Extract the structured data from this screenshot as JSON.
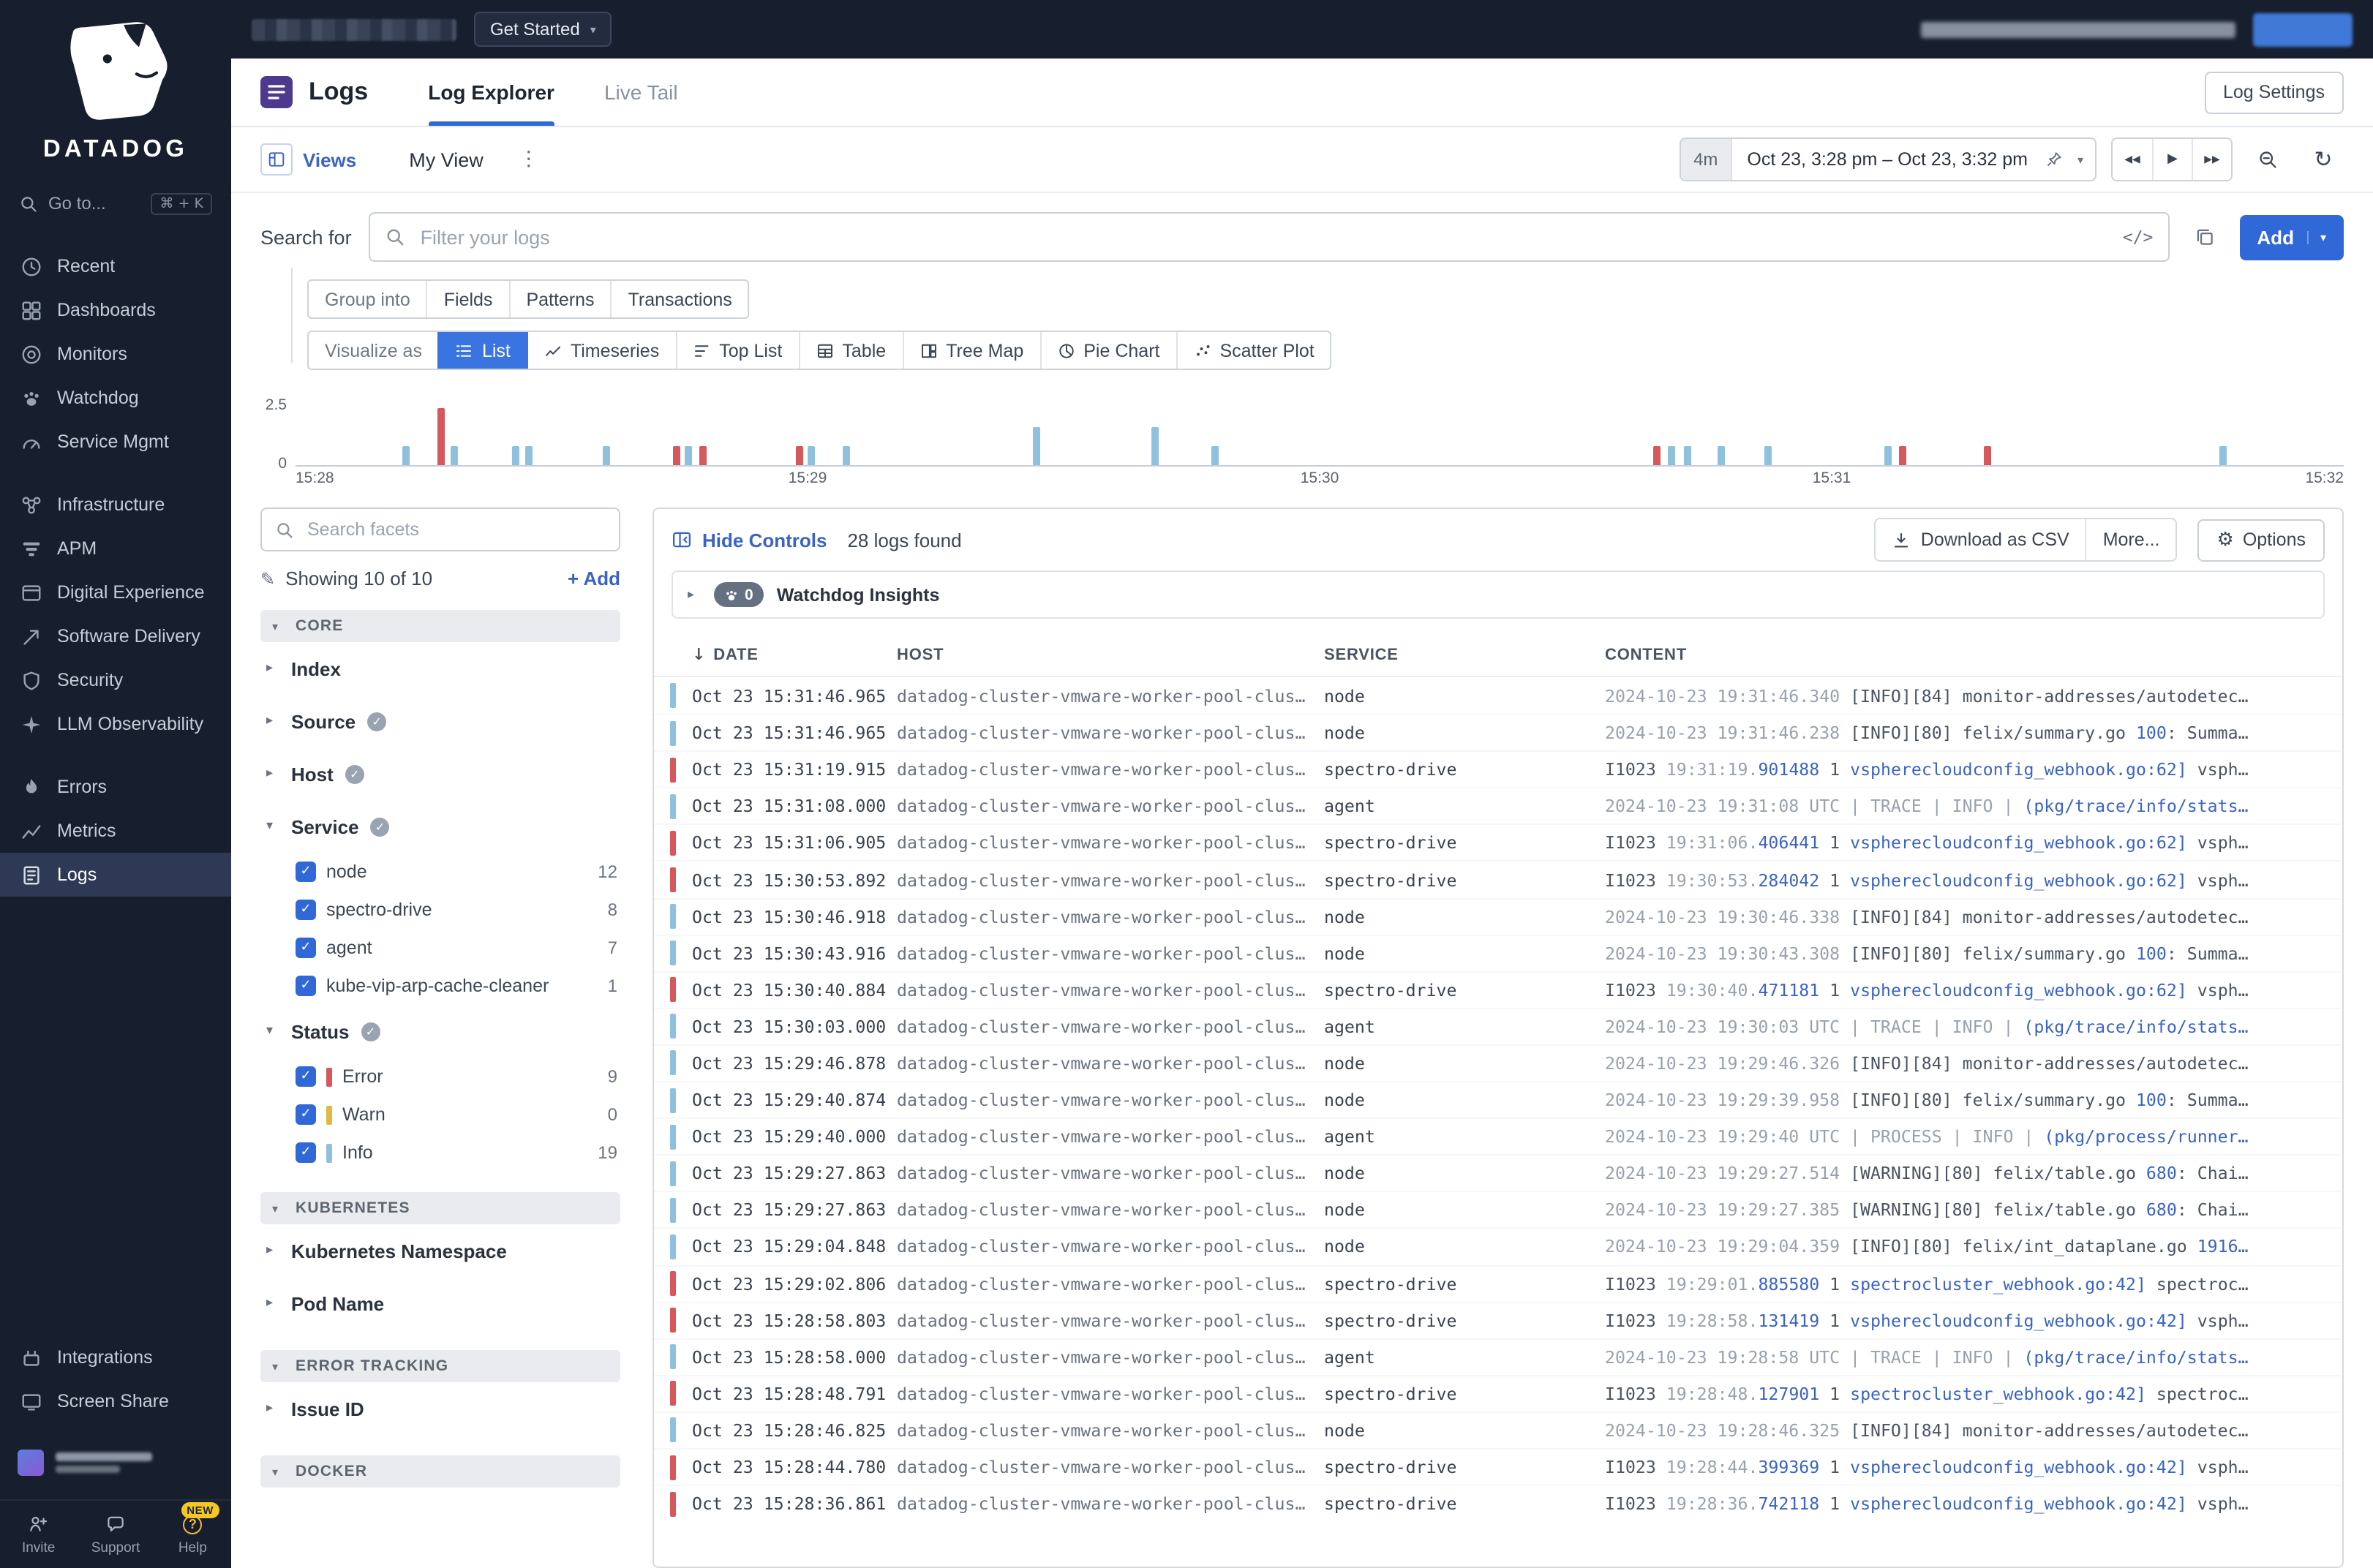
{
  "topbar": {
    "get_started": "Get Started"
  },
  "sidebar": {
    "brand": "DATADOG",
    "goto": {
      "label": "Go to...",
      "shortcut": "⌘ + K"
    },
    "groups": [
      {
        "items": [
          {
            "icon": "clock",
            "label": "Recent"
          },
          {
            "icon": "dashboards",
            "label": "Dashboards"
          },
          {
            "icon": "monitors",
            "label": "Monitors"
          },
          {
            "icon": "watchdog",
            "label": "Watchdog"
          },
          {
            "icon": "service-mgmt",
            "label": "Service Mgmt"
          }
        ]
      },
      {
        "items": [
          {
            "icon": "infrastructure",
            "label": "Infrastructure"
          },
          {
            "icon": "apm",
            "label": "APM"
          },
          {
            "icon": "digital-experience",
            "label": "Digital Experience"
          },
          {
            "icon": "software-delivery",
            "label": "Software Delivery"
          },
          {
            "icon": "security",
            "label": "Security"
          },
          {
            "icon": "llm",
            "label": "LLM Observability"
          }
        ]
      },
      {
        "items": [
          {
            "icon": "errors",
            "label": "Errors"
          },
          {
            "icon": "metrics",
            "label": "Metrics"
          },
          {
            "icon": "logs",
            "label": "Logs",
            "active": true
          }
        ]
      },
      {
        "items": [
          {
            "icon": "integrations",
            "label": "Integrations"
          },
          {
            "icon": "screen-share",
            "label": "Screen Share"
          }
        ]
      }
    ],
    "footer": [
      {
        "icon": "invite",
        "label": "Invite"
      },
      {
        "icon": "support",
        "label": "Support"
      },
      {
        "icon": "help",
        "label": "Help",
        "badge": "NEW"
      }
    ]
  },
  "header": {
    "product": "Logs",
    "tabs": [
      {
        "label": "Log Explorer",
        "active": true
      },
      {
        "label": "Live Tail"
      }
    ],
    "settings_button": "Log Settings"
  },
  "viewbar": {
    "views_label": "Views",
    "view_name": "My View",
    "time_range": {
      "duration": "4m",
      "text": "Oct 23, 3:28 pm – Oct 23, 3:32 pm"
    }
  },
  "search": {
    "label": "Search for",
    "placeholder": "Filter your logs",
    "add_button": "Add"
  },
  "group_into": {
    "label": "Group into",
    "tabs": [
      "Fields",
      "Patterns",
      "Transactions"
    ]
  },
  "visualize": {
    "label": "Visualize as",
    "tabs": [
      {
        "icon": "list",
        "label": "List",
        "active": true
      },
      {
        "icon": "timeseries",
        "label": "Timeseries"
      },
      {
        "icon": "toplist",
        "label": "Top List"
      },
      {
        "icon": "table",
        "label": "Table"
      },
      {
        "icon": "treemap",
        "label": "Tree Map"
      },
      {
        "icon": "pie",
        "label": "Pie Chart"
      },
      {
        "icon": "scatter",
        "label": "Scatter Plot"
      }
    ]
  },
  "chart_data": {
    "type": "bar",
    "title": "Log count over time",
    "x_ticks": [
      "15:28",
      "15:29",
      "15:30",
      "15:31",
      "15:32"
    ],
    "y_ticks": [
      "0",
      "2.5"
    ],
    "y_max": 3,
    "legend": [
      {
        "name": "Info",
        "color": "#8fc1de"
      },
      {
        "name": "Error",
        "color": "#d4585c"
      }
    ],
    "bars": [
      {
        "x": 0.052,
        "value": 1,
        "status": "info"
      },
      {
        "x": 0.069,
        "value": 3,
        "status": "error"
      },
      {
        "x": 0.076,
        "value": 1,
        "status": "info"
      },
      {
        "x": 0.106,
        "value": 1,
        "status": "info"
      },
      {
        "x": 0.112,
        "value": 1,
        "status": "info"
      },
      {
        "x": 0.15,
        "value": 1,
        "status": "info"
      },
      {
        "x": 0.184,
        "value": 1,
        "status": "error"
      },
      {
        "x": 0.19,
        "value": 1,
        "status": "info"
      },
      {
        "x": 0.197,
        "value": 1,
        "status": "error"
      },
      {
        "x": 0.244,
        "value": 1,
        "status": "error"
      },
      {
        "x": 0.25,
        "value": 1,
        "status": "info"
      },
      {
        "x": 0.267,
        "value": 1,
        "status": "info"
      },
      {
        "x": 0.36,
        "value": 2,
        "status": "info"
      },
      {
        "x": 0.418,
        "value": 2,
        "status": "info"
      },
      {
        "x": 0.447,
        "value": 1,
        "status": "info"
      },
      {
        "x": 0.663,
        "value": 1,
        "status": "error"
      },
      {
        "x": 0.67,
        "value": 1,
        "status": "info"
      },
      {
        "x": 0.678,
        "value": 1,
        "status": "info"
      },
      {
        "x": 0.694,
        "value": 1,
        "status": "info"
      },
      {
        "x": 0.717,
        "value": 1,
        "status": "info"
      },
      {
        "x": 0.776,
        "value": 1,
        "status": "info"
      },
      {
        "x": 0.783,
        "value": 1,
        "status": "error"
      },
      {
        "x": 0.824,
        "value": 1,
        "status": "error"
      },
      {
        "x": 0.939,
        "value": 1,
        "status": "info"
      }
    ]
  },
  "controls": {
    "hide_controls": "Hide Controls",
    "logs_found": "28 logs found",
    "download_csv": "Download as CSV",
    "more": "More...",
    "options": "Options"
  },
  "watchdog": {
    "count": "0",
    "label": "Watchdog Insights"
  },
  "facets": {
    "search_placeholder": "Search facets",
    "showing": "Showing 10 of 10",
    "add_label": "Add",
    "sections": [
      {
        "title": "CORE",
        "items": [
          {
            "label": "Index"
          },
          {
            "label": "Source",
            "badge": true
          },
          {
            "label": "Host",
            "badge": true
          },
          {
            "label": "Service",
            "badge": true,
            "expanded": true,
            "values": [
              {
                "label": "node",
                "count": "12",
                "checked": true
              },
              {
                "label": "spectro-drive",
                "count": "8",
                "checked": true
              },
              {
                "label": "agent",
                "count": "7",
                "checked": true
              },
              {
                "label": "kube-vip-arp-cache-cleaner",
                "count": "1",
                "checked": true
              }
            ]
          },
          {
            "label": "Status",
            "badge": true,
            "expanded": true,
            "values": [
              {
                "label": "Error",
                "count": "9",
                "checked": true,
                "swatch": "#d4585c"
              },
              {
                "label": "Warn",
                "count": "0",
                "checked": true,
                "swatch": "#e2b93c"
              },
              {
                "label": "Info",
                "count": "19",
                "checked": true,
                "swatch": "#8fc1de"
              }
            ]
          }
        ]
      },
      {
        "title": "KUBERNETES",
        "items": [
          {
            "label": "Kubernetes Namespace"
          },
          {
            "label": "Pod Name"
          }
        ]
      },
      {
        "title": "ERROR TRACKING",
        "items": [
          {
            "label": "Issue ID"
          }
        ]
      },
      {
        "title": "DOCKER",
        "items": []
      }
    ]
  },
  "logs": {
    "columns": [
      "DATE",
      "HOST",
      "SERVICE",
      "CONTENT"
    ],
    "rows": [
      {
        "status": "info",
        "date": "Oct 23 15:31:46.965",
        "host": "datadog-cluster-vmware-worker-pool-clus…",
        "service": "node",
        "content": [
          [
            "m",
            "2024-10-23 19:31:46.340 "
          ],
          [
            "p",
            "[INFO][84] monitor-addresses/autodetec…"
          ]
        ]
      },
      {
        "status": "info",
        "date": "Oct 23 15:31:46.965",
        "host": "datadog-cluster-vmware-worker-pool-clus…",
        "service": "node",
        "content": [
          [
            "m",
            "2024-10-23 19:31:46.238 "
          ],
          [
            "p",
            "[INFO][80] felix/summary.go "
          ],
          [
            "l",
            "100"
          ],
          [
            "p",
            ": Summa…"
          ]
        ]
      },
      {
        "status": "error",
        "date": "Oct 23 15:31:19.915",
        "host": "datadog-cluster-vmware-worker-pool-clus…",
        "service": "spectro-drive",
        "content": [
          [
            "p",
            "I1023 "
          ],
          [
            "m",
            "19:31:19."
          ],
          [
            "l",
            "901488"
          ],
          [
            "p",
            " 1 "
          ],
          [
            "l",
            "vspherecloudconfig_webhook.go:62]"
          ],
          [
            "p",
            " vsph…"
          ]
        ]
      },
      {
        "status": "info",
        "date": "Oct 23 15:31:08.000",
        "host": "datadog-cluster-vmware-worker-pool-clus…",
        "service": "agent",
        "content": [
          [
            "m",
            "2024-10-23 19:31:08 UTC | TRACE | INFO | "
          ],
          [
            "l",
            "(pkg/trace/info/stats…"
          ]
        ]
      },
      {
        "status": "error",
        "date": "Oct 23 15:31:06.905",
        "host": "datadog-cluster-vmware-worker-pool-clus…",
        "service": "spectro-drive",
        "content": [
          [
            "p",
            "I1023 "
          ],
          [
            "m",
            "19:31:06."
          ],
          [
            "l",
            "406441"
          ],
          [
            "p",
            " 1 "
          ],
          [
            "l",
            "vspherecloudconfig_webhook.go:62]"
          ],
          [
            "p",
            " vsph…"
          ]
        ]
      },
      {
        "status": "error",
        "date": "Oct 23 15:30:53.892",
        "host": "datadog-cluster-vmware-worker-pool-clus…",
        "service": "spectro-drive",
        "content": [
          [
            "p",
            "I1023 "
          ],
          [
            "m",
            "19:30:53."
          ],
          [
            "l",
            "284042"
          ],
          [
            "p",
            " 1 "
          ],
          [
            "l",
            "vspherecloudconfig_webhook.go:62]"
          ],
          [
            "p",
            " vsph…"
          ]
        ]
      },
      {
        "status": "info",
        "date": "Oct 23 15:30:46.918",
        "host": "datadog-cluster-vmware-worker-pool-clus…",
        "service": "node",
        "content": [
          [
            "m",
            "2024-10-23 19:30:46.338 "
          ],
          [
            "p",
            "[INFO][84] monitor-addresses/autodetec…"
          ]
        ]
      },
      {
        "status": "info",
        "date": "Oct 23 15:30:43.916",
        "host": "datadog-cluster-vmware-worker-pool-clus…",
        "service": "node",
        "content": [
          [
            "m",
            "2024-10-23 19:30:43.308 "
          ],
          [
            "p",
            "[INFO][80] felix/summary.go "
          ],
          [
            "l",
            "100"
          ],
          [
            "p",
            ": Summa…"
          ]
        ]
      },
      {
        "status": "error",
        "date": "Oct 23 15:30:40.884",
        "host": "datadog-cluster-vmware-worker-pool-clus…",
        "service": "spectro-drive",
        "content": [
          [
            "p",
            "I1023 "
          ],
          [
            "m",
            "19:30:40."
          ],
          [
            "l",
            "471181"
          ],
          [
            "p",
            " 1 "
          ],
          [
            "l",
            "vspherecloudconfig_webhook.go:62]"
          ],
          [
            "p",
            " vsph…"
          ]
        ]
      },
      {
        "status": "info",
        "date": "Oct 23 15:30:03.000",
        "host": "datadog-cluster-vmware-worker-pool-clus…",
        "service": "agent",
        "content": [
          [
            "m",
            "2024-10-23 19:30:03 UTC | TRACE | INFO | "
          ],
          [
            "l",
            "(pkg/trace/info/stats…"
          ]
        ]
      },
      {
        "status": "info",
        "date": "Oct 23 15:29:46.878",
        "host": "datadog-cluster-vmware-worker-pool-clus…",
        "service": "node",
        "content": [
          [
            "m",
            "2024-10-23 19:29:46.326 "
          ],
          [
            "p",
            "[INFO][84] monitor-addresses/autodetec…"
          ]
        ]
      },
      {
        "status": "info",
        "date": "Oct 23 15:29:40.874",
        "host": "datadog-cluster-vmware-worker-pool-clus…",
        "service": "node",
        "content": [
          [
            "m",
            "2024-10-23 19:29:39.958 "
          ],
          [
            "p",
            "[INFO][80] felix/summary.go "
          ],
          [
            "l",
            "100"
          ],
          [
            "p",
            ": Summa…"
          ]
        ]
      },
      {
        "status": "info",
        "date": "Oct 23 15:29:40.000",
        "host": "datadog-cluster-vmware-worker-pool-clus…",
        "service": "agent",
        "content": [
          [
            "m",
            "2024-10-23 19:29:40 UTC | PROCESS | INFO | "
          ],
          [
            "l",
            "(pkg/process/runner…"
          ]
        ]
      },
      {
        "status": "info",
        "date": "Oct 23 15:29:27.863",
        "host": "datadog-cluster-vmware-worker-pool-clus…",
        "service": "node",
        "content": [
          [
            "m",
            "2024-10-23 19:29:27.514 "
          ],
          [
            "p",
            "[WARNING][80] felix/table.go "
          ],
          [
            "l",
            "680"
          ],
          [
            "p",
            ": Chai…"
          ]
        ]
      },
      {
        "status": "info",
        "date": "Oct 23 15:29:27.863",
        "host": "datadog-cluster-vmware-worker-pool-clus…",
        "service": "node",
        "content": [
          [
            "m",
            "2024-10-23 19:29:27.385 "
          ],
          [
            "p",
            "[WARNING][80] felix/table.go "
          ],
          [
            "l",
            "680"
          ],
          [
            "p",
            ": Chai…"
          ]
        ]
      },
      {
        "status": "info",
        "date": "Oct 23 15:29:04.848",
        "host": "datadog-cluster-vmware-worker-pool-clus…",
        "service": "node",
        "content": [
          [
            "m",
            "2024-10-23 19:29:04.359 "
          ],
          [
            "p",
            "[INFO][80] felix/int_dataplane.go "
          ],
          [
            "l",
            "1916…"
          ]
        ]
      },
      {
        "status": "error",
        "date": "Oct 23 15:29:02.806",
        "host": "datadog-cluster-vmware-worker-pool-clus…",
        "service": "spectro-drive",
        "content": [
          [
            "p",
            "I1023 "
          ],
          [
            "m",
            "19:29:01."
          ],
          [
            "l",
            "885580"
          ],
          [
            "p",
            " 1 "
          ],
          [
            "l",
            "spectrocluster_webhook.go:42]"
          ],
          [
            "p",
            " spectroc…"
          ]
        ]
      },
      {
        "status": "error",
        "date": "Oct 23 15:28:58.803",
        "host": "datadog-cluster-vmware-worker-pool-clus…",
        "service": "spectro-drive",
        "content": [
          [
            "p",
            "I1023 "
          ],
          [
            "m",
            "19:28:58."
          ],
          [
            "l",
            "131419"
          ],
          [
            "p",
            " 1 "
          ],
          [
            "l",
            "vspherecloudconfig_webhook.go:42]"
          ],
          [
            "p",
            " vsph…"
          ]
        ]
      },
      {
        "status": "info",
        "date": "Oct 23 15:28:58.000",
        "host": "datadog-cluster-vmware-worker-pool-clus…",
        "service": "agent",
        "content": [
          [
            "m",
            "2024-10-23 19:28:58 UTC | TRACE | INFO | "
          ],
          [
            "l",
            "(pkg/trace/info/stats…"
          ]
        ]
      },
      {
        "status": "error",
        "date": "Oct 23 15:28:48.791",
        "host": "datadog-cluster-vmware-worker-pool-clus…",
        "service": "spectro-drive",
        "content": [
          [
            "p",
            "I1023 "
          ],
          [
            "m",
            "19:28:48."
          ],
          [
            "l",
            "127901"
          ],
          [
            "p",
            " 1 "
          ],
          [
            "l",
            "spectrocluster_webhook.go:42]"
          ],
          [
            "p",
            " spectroc…"
          ]
        ]
      },
      {
        "status": "info",
        "date": "Oct 23 15:28:46.825",
        "host": "datadog-cluster-vmware-worker-pool-clus…",
        "service": "node",
        "content": [
          [
            "m",
            "2024-10-23 19:28:46.325 "
          ],
          [
            "p",
            "[INFO][84] monitor-addresses/autodetec…"
          ]
        ]
      },
      {
        "status": "error",
        "date": "Oct 23 15:28:44.780",
        "host": "datadog-cluster-vmware-worker-pool-clus…",
        "service": "spectro-drive",
        "content": [
          [
            "p",
            "I1023 "
          ],
          [
            "m",
            "19:28:44."
          ],
          [
            "l",
            "399369"
          ],
          [
            "p",
            " 1 "
          ],
          [
            "l",
            "vspherecloudconfig_webhook.go:42]"
          ],
          [
            "p",
            " vsph…"
          ]
        ]
      },
      {
        "status": "error",
        "date": "Oct 23 15:28:36.861",
        "host": "datadog-cluster-vmware-worker-pool-clus…",
        "service": "spectro-drive",
        "content": [
          [
            "p",
            "I1023 "
          ],
          [
            "m",
            "19:28:36."
          ],
          [
            "l",
            "742118"
          ],
          [
            "p",
            " 1 "
          ],
          [
            "l",
            "vspherecloudconfig_webhook.go:42]"
          ],
          [
            "p",
            " vsph…"
          ]
        ]
      }
    ]
  }
}
